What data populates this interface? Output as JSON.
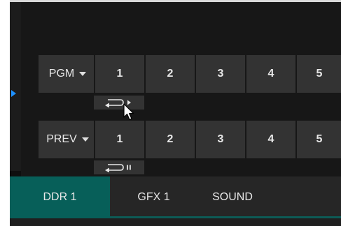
{
  "pgm_row": {
    "label": "PGM",
    "sources": [
      "1",
      "2",
      "3",
      "4",
      "5"
    ]
  },
  "prev_row": {
    "label": "PREV",
    "sources": [
      "1",
      "2",
      "3",
      "4",
      "5"
    ]
  },
  "transport": {
    "pgm_control_icon": "loop-play-icon",
    "prev_control_icon": "loop-pause-icon"
  },
  "tabs": [
    "DDR 1",
    "GFX 1",
    "SOUND"
  ],
  "active_tab": "DDR 1",
  "colors": {
    "active_tab": "#075f59",
    "button_bg": "#333333",
    "accent_arrow": "#1e90ff"
  }
}
